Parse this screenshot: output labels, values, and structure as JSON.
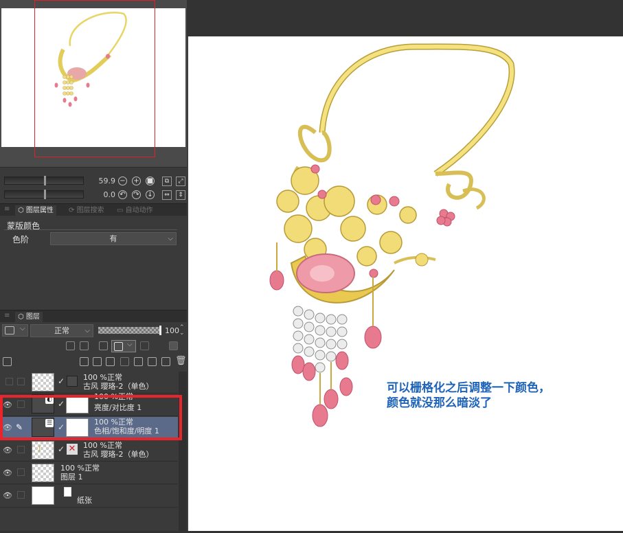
{
  "navigator": {
    "zoom_value": "59.9",
    "rotation_value": "0.0"
  },
  "tabs": {
    "layer_property": "图层属性",
    "layer_search": "图层搜索",
    "auto_action": "自动动作"
  },
  "properties": {
    "section_title": "蒙版颜色",
    "level_label": "色阶",
    "level_value": "有"
  },
  "layers_panel": {
    "title": "图层",
    "blend_mode": "正常",
    "opacity": "100",
    "rows": [
      {
        "line1": "100 %正常",
        "line2": "古风 璎珞-2（单色）"
      },
      {
        "line1": "100 %正常",
        "line2": "亮度/对比度 1"
      },
      {
        "line1": "100 %正常",
        "line2": "色相/饱和度/明度 1"
      },
      {
        "line1": "100 %正常",
        "line2": "古风 璎珞-2（单色）"
      },
      {
        "line1": "100 %正常",
        "line2": "图层 1"
      },
      {
        "line1": "",
        "line2": "纸张"
      }
    ]
  },
  "annotation": {
    "line1": "可以栅格化之后调整一下颜色，",
    "line2": "颜色就没那么暗淡了"
  },
  "colors": {
    "highlight_box": "#e8252a",
    "annotation_text": "#1e63b8",
    "selected_row": "#5b6a88",
    "necklace_gold": "#f2e27a",
    "necklace_pink": "#e87a90"
  }
}
